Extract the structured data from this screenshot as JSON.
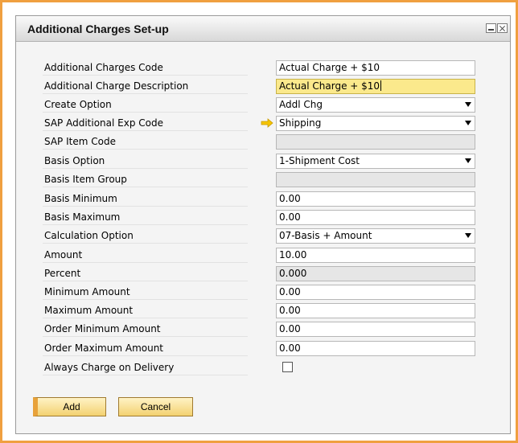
{
  "window": {
    "title": "Additional Charges Set-up"
  },
  "form": {
    "rows": [
      {
        "label": "Additional Charges Code",
        "value": "Actual Charge + $10",
        "type": "text"
      },
      {
        "label": "Additional Charge Description",
        "value": "Actual Charge + $10",
        "type": "text-focused"
      },
      {
        "label": "Create Option",
        "value": "Addl Chg",
        "type": "select"
      },
      {
        "label": "SAP Additional Exp Code",
        "value": "Shipping",
        "type": "select-link"
      },
      {
        "label": "SAP Item Code",
        "value": "",
        "type": "readonly"
      },
      {
        "label": "Basis Option",
        "value": "1-Shipment Cost",
        "type": "select"
      },
      {
        "label": "Basis Item Group",
        "value": "",
        "type": "readonly"
      },
      {
        "label": "Basis Minimum",
        "value": "0.00",
        "type": "text"
      },
      {
        "label": "Basis Maximum",
        "value": "0.00",
        "type": "text"
      },
      {
        "label": "Calculation Option",
        "value": "07-Basis + Amount",
        "type": "select"
      },
      {
        "label": "Amount",
        "value": "10.00",
        "type": "text"
      },
      {
        "label": "Percent",
        "value": "0.000",
        "type": "readonly"
      },
      {
        "label": "Minimum Amount",
        "value": "0.00",
        "type": "text"
      },
      {
        "label": "Maximum Amount",
        "value": "0.00",
        "type": "text"
      },
      {
        "label": "Order Minimum Amount",
        "value": "0.00",
        "type": "text"
      },
      {
        "label": "Order Maximum Amount",
        "value": "0.00",
        "type": "text"
      },
      {
        "label": "Always Charge on Delivery",
        "value": "",
        "type": "checkbox"
      }
    ]
  },
  "buttons": {
    "add_label": "Add",
    "cancel_label": "Cancel"
  },
  "colors": {
    "accent_border": "#f0a040",
    "focus_field": "#fbe98c",
    "button_fill": "#f3d170",
    "link_arrow": "#f5c400"
  }
}
